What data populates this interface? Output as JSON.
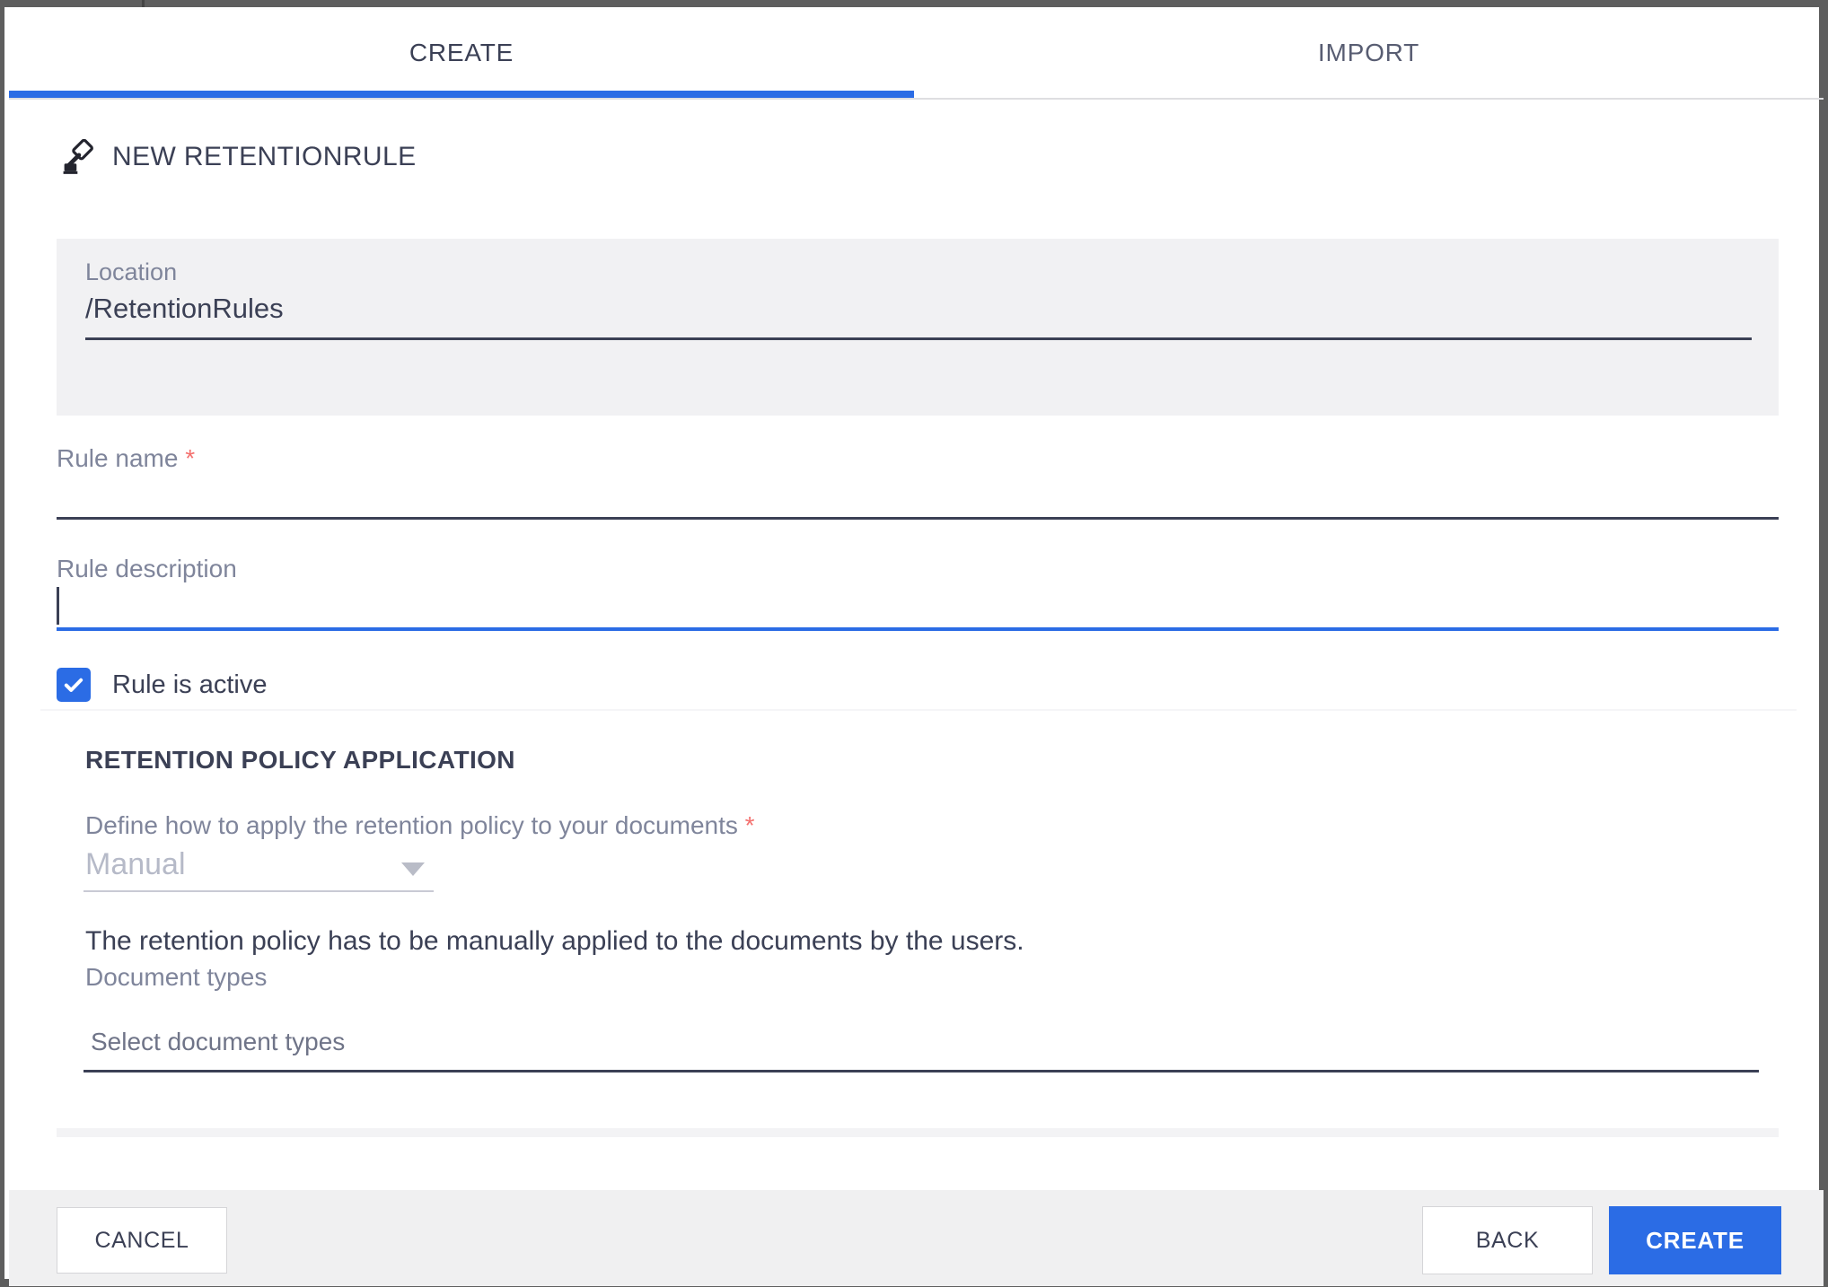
{
  "tabs": {
    "create": "CREATE",
    "import": "IMPORT"
  },
  "header": {
    "title": "NEW RETENTIONRULE",
    "icon": "gavel-icon"
  },
  "location": {
    "label": "Location",
    "value": "/RetentionRules"
  },
  "fields": {
    "rule_name": {
      "label": "Rule name",
      "required_marker": "*",
      "value": ""
    },
    "rule_description": {
      "label": "Rule description",
      "value": ""
    },
    "rule_active": {
      "label": "Rule is active",
      "checked": true
    }
  },
  "retention_policy_application": {
    "title": "RETENTION POLICY APPLICATION",
    "apply_method": {
      "label": "Define how to apply the retention policy to your documents",
      "required_marker": "*",
      "value": "Manual",
      "hint": "The retention policy has to be manually applied to the documents by the users."
    },
    "document_types": {
      "label": "Document types",
      "placeholder": "Select document types",
      "value": ""
    }
  },
  "footer": {
    "cancel": "CANCEL",
    "back": "BACK",
    "create": "CREATE"
  },
  "colors": {
    "accent_blue": "#2b6ce5",
    "required_red": "#f4716f",
    "text_dark": "#3b4055",
    "label_gray": "#7f859b",
    "footer_bg": "#f0f0f1",
    "location_box_bg": "#f1f1f3"
  }
}
